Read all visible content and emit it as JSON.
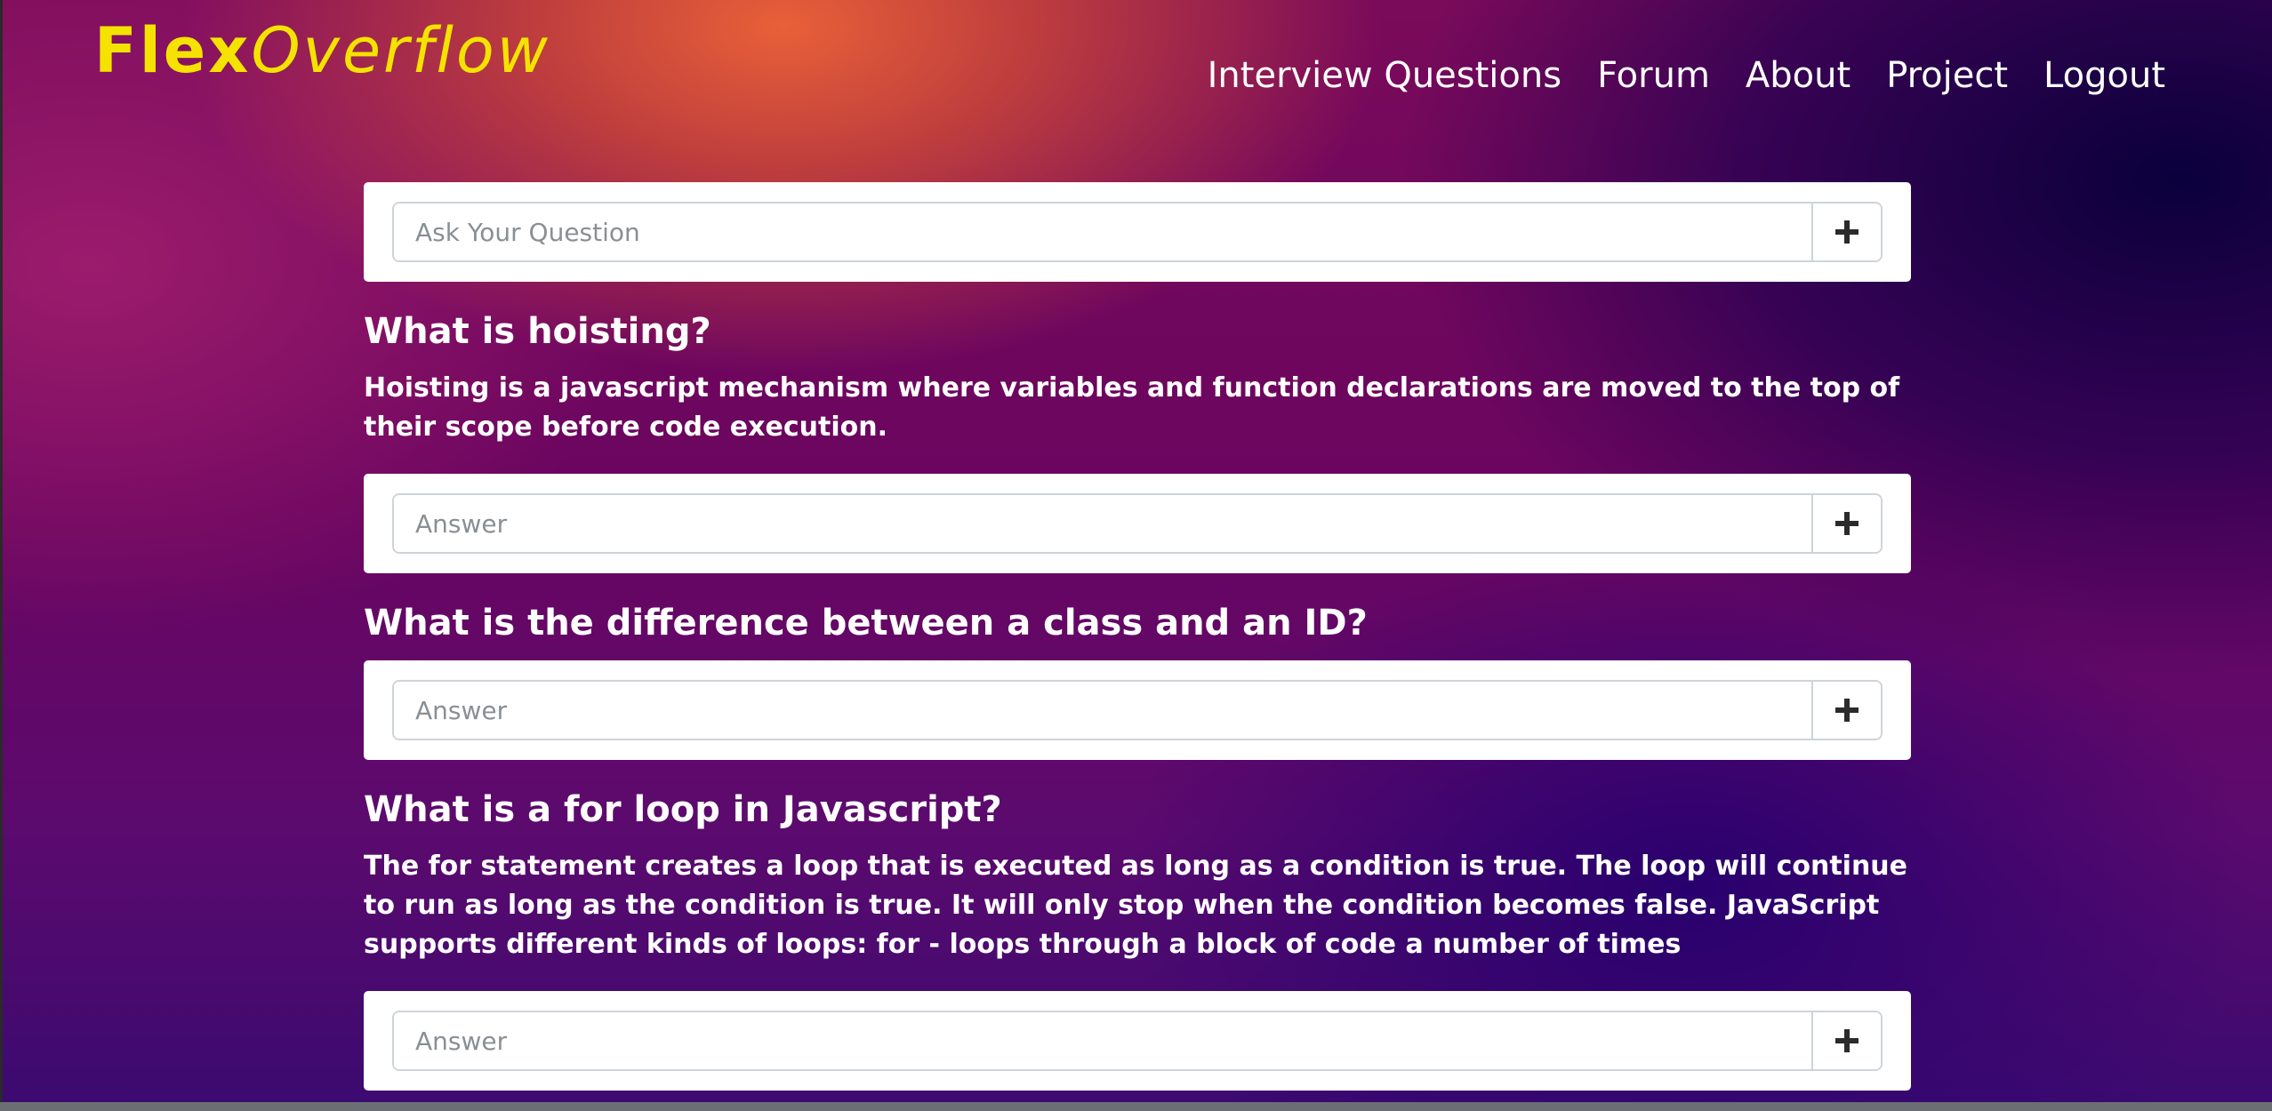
{
  "brand": {
    "part1": "Flex",
    "part2": "Overflow",
    "color": "#f4e300"
  },
  "nav": {
    "items": [
      {
        "label": "Interview Questions"
      },
      {
        "label": "Forum"
      },
      {
        "label": "About"
      },
      {
        "label": "Project"
      },
      {
        "label": "Logout"
      }
    ]
  },
  "ask": {
    "placeholder": "Ask Your Question",
    "icon": "plus-icon"
  },
  "questions": [
    {
      "title": "What is hoisting?",
      "answer": "Hoisting is a javascript mechanism where variables and function declarations are moved to the top of their scope before code execution.",
      "answer_placeholder": "Answer"
    },
    {
      "title": "What is the difference between a class and an ID?",
      "answer": "",
      "answer_placeholder": "Answer"
    },
    {
      "title": "What is a for loop in Javascript?",
      "answer": "The for statement creates a loop that is executed as long as a condition is true. The loop will continue to run as long as the condition is true. It will only stop when the condition becomes false. JavaScript supports different kinds of loops: for - loops through a block of code a number of times",
      "answer_placeholder": "Answer"
    }
  ],
  "colors": {
    "accent": "#f4e300",
    "card_bg": "#ffffff",
    "text": "#ffffff"
  }
}
